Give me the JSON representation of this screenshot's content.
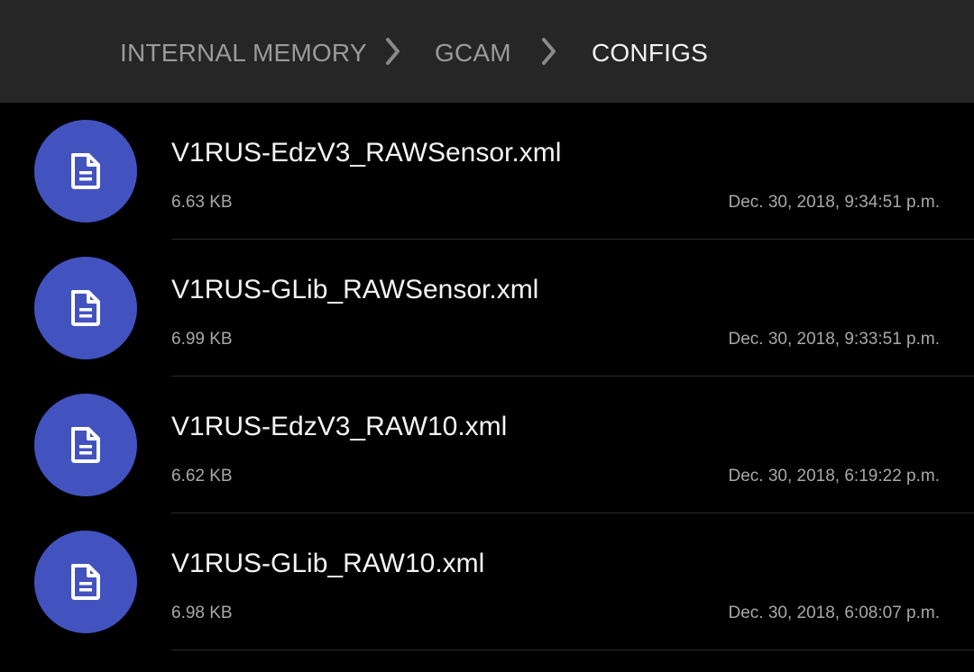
{
  "breadcrumb": {
    "items": [
      {
        "label": "INTERNAL MEMORY"
      },
      {
        "label": "GCAM"
      },
      {
        "label": "CONFIGS"
      }
    ],
    "separator_icon": "chevron-right-icon"
  },
  "colors": {
    "header_bg": "#262626",
    "list_bg": "#000000",
    "icon_circle": "#4253c0",
    "primary_text": "#f4f4f4",
    "secondary_text": "#a8a8a8"
  },
  "files": [
    {
      "name": "V1RUS-EdzV3_RAWSensor.xml",
      "size": "6.63 KB",
      "date": "Dec. 30, 2018, 9:34:51 p.m.",
      "icon": "document-icon"
    },
    {
      "name": "V1RUS-GLib_RAWSensor.xml",
      "size": "6.99 KB",
      "date": "Dec. 30, 2018, 9:33:51 p.m.",
      "icon": "document-icon"
    },
    {
      "name": "V1RUS-EdzV3_RAW10.xml",
      "size": "6.62 KB",
      "date": "Dec. 30, 2018, 6:19:22 p.m.",
      "icon": "document-icon"
    },
    {
      "name": "V1RUS-GLib_RAW10.xml",
      "size": "6.98 KB",
      "date": "Dec. 30, 2018, 6:08:07 p.m.",
      "icon": "document-icon"
    }
  ]
}
